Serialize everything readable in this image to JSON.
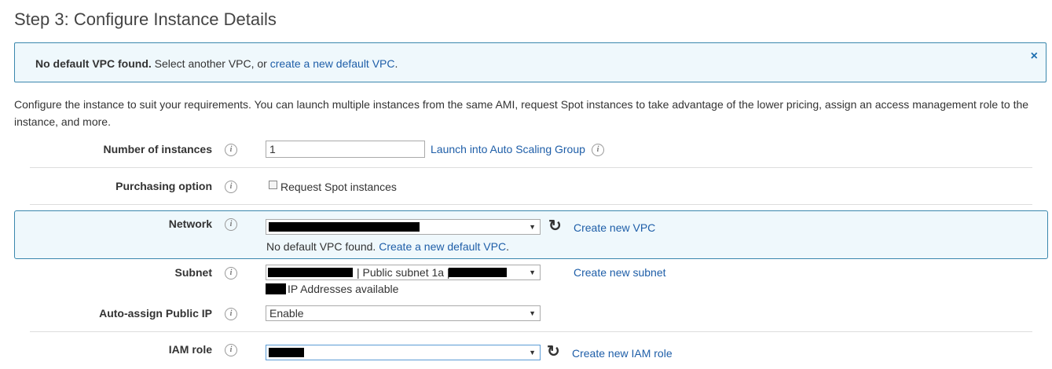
{
  "title": "Step 3: Configure Instance Details",
  "alert": {
    "bold": "No default VPC found.",
    "text": " Select another VPC, or ",
    "link": "create a new default VPC",
    "tail": ".",
    "close": "×"
  },
  "intro": "Configure the instance to suit your requirements. You can launch multiple instances from the same AMI, request Spot instances to take advantage of the lower pricing, assign an access management role to the instance, and more.",
  "fields": {
    "instances": {
      "label": "Number of instances",
      "value": "1",
      "link": "Launch into Auto Scaling Group"
    },
    "purchasing": {
      "label": "Purchasing option",
      "checkbox_label": "Request Spot instances"
    },
    "network": {
      "label": "Network",
      "link": "Create new VPC",
      "msg": "No default VPC found.",
      "msg_link": "Create a new default VPC",
      "msg_tail": "."
    },
    "subnet": {
      "label": "Subnet",
      "mid_text": "| Public subnet 1a |",
      "link": "Create new subnet",
      "ip_text": "IP Addresses available"
    },
    "public_ip": {
      "label": "Auto-assign Public IP",
      "value": "Enable"
    },
    "iam": {
      "label": "IAM role",
      "link": "Create new IAM role"
    }
  },
  "icons": {
    "info": "i",
    "refresh": "↻",
    "arrow": "▼"
  },
  "colors": {
    "link": "#1e5ea8",
    "panel_bg": "#eff8fc",
    "panel_border": "#3a87ad"
  }
}
